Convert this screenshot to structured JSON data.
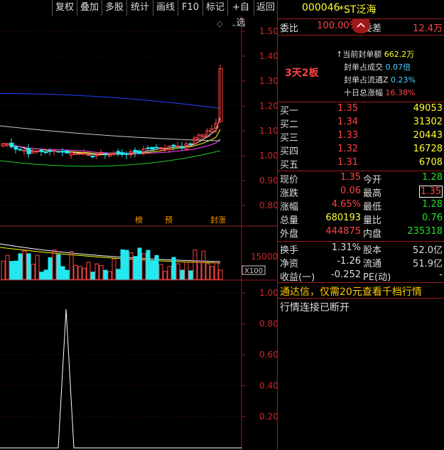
{
  "toolbar": {
    "buttons": [
      "复权",
      "叠加",
      "多股",
      "统计",
      "画线",
      "F10",
      "标记",
      "+自选",
      "返回"
    ]
  },
  "stock": {
    "code": "000046",
    "name": "*ST泛海"
  },
  "header": {
    "weibi_label": "委比",
    "weibi_value": "100.00%",
    "weicha_label": "委差",
    "weicha_value": "12.4万"
  },
  "badge": "3天2板",
  "seal": [
    {
      "label": "当前封单额",
      "value": "662.2万"
    },
    {
      "label": "封单占成交",
      "value": "0.07倍"
    },
    {
      "label": "封单占流通Z",
      "value": "0.23%"
    },
    {
      "label": "十日总涨幅",
      "value": "16.38%"
    }
  ],
  "orders": [
    {
      "label": "买一",
      "price": "1.35",
      "volume": "49053"
    },
    {
      "label": "买二",
      "price": "1.34",
      "volume": "31302"
    },
    {
      "label": "买三",
      "price": "1.33",
      "volume": "20443"
    },
    {
      "label": "买四",
      "price": "1.32",
      "volume": "16728"
    },
    {
      "label": "买五",
      "price": "1.31",
      "volume": "6708"
    }
  ],
  "quote": [
    {
      "l1": "现价",
      "v1": "1.35",
      "l2": "今开",
      "v2": "1.28"
    },
    {
      "l1": "涨跌",
      "v1": "0.06",
      "l2": "最高",
      "v2": "1.35"
    },
    {
      "l1": "涨幅",
      "v1": "4.65%",
      "l2": "最低",
      "v2": "1.28"
    },
    {
      "l1": "总量",
      "v1": "680193",
      "l2": "量比",
      "v2": "0.76"
    },
    {
      "l1": "外盘",
      "v1": "444875",
      "l2": "内盘",
      "v2": "235318"
    }
  ],
  "fundamentals": [
    {
      "l1": "换手",
      "v1": "1.31%",
      "l2": "股本",
      "v2": "52.0亿"
    },
    {
      "l1": "净资",
      "v1": "-1.26",
      "l2": "流通",
      "v2": "51.9亿"
    },
    {
      "l1": "收益(一)",
      "v1": "-0.252",
      "l2": "PE(动)",
      "v2": "-"
    }
  ],
  "ad_text": "通达信，仅需20元查看千档行情",
  "status_text": "行情连接已断开",
  "chart": {
    "price_ticks": [
      "1.50",
      "1.40",
      "1.30",
      "1.20",
      "1.10",
      "1.00",
      "0.90",
      "0.80"
    ],
    "volume_tick": "15000",
    "volume_unit": "X100",
    "ind_ticks": [
      "1.00",
      "0.80",
      "0.60",
      "0.40",
      "0.20"
    ],
    "markers": [
      "榜",
      "预",
      "封涨"
    ],
    "diamond": "◇"
  },
  "colors": {
    "up": "#ff4444",
    "down": "#22e8f0",
    "ma5": "#ffffff",
    "ma10": "#ffff00",
    "ma20": "#ff44ff",
    "ma60": "#22cc22",
    "ma120": "#2244ff",
    "ma250": "#cccccc",
    "border": "#9b1c1c"
  }
}
